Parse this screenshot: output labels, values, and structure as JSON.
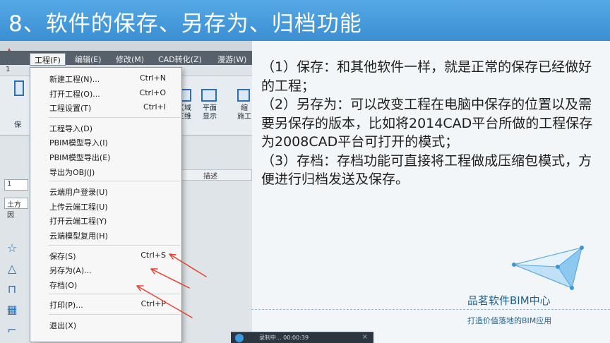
{
  "slide": {
    "title": "8、软件的保存、另存为、归档功能"
  },
  "app": {
    "menubar": [
      {
        "label": "工程(F)",
        "active": true
      },
      {
        "label": "编辑(E)",
        "active": false
      },
      {
        "label": "修改(M)",
        "active": false
      },
      {
        "label": "CAD转化(Z)",
        "active": false
      },
      {
        "label": "漫游(W)",
        "active": false
      }
    ],
    "ribbon_buttons": [
      {
        "label": "区域\n三维"
      },
      {
        "label": "平面\n显示"
      },
      {
        "label": "缩\n施工"
      }
    ],
    "ribbon_left_label": "保",
    "tab_label": "1",
    "desc_column": "描述",
    "side_inputs": [
      "1",
      "土方因"
    ],
    "side_tools": [
      "star-icon",
      "mountain-icon",
      "pipe-icon",
      "building-icon",
      "hook-icon"
    ],
    "file_menu": {
      "groups": [
        [
          {
            "label": "新建工程(N)...",
            "shortcut": "Ctrl+N"
          },
          {
            "label": "打开工程(O)...",
            "shortcut": "Ctrl+O"
          },
          {
            "label": "工程设置(T)",
            "shortcut": "Ctrl+I"
          }
        ],
        [
          {
            "label": "工程导入(D)",
            "shortcut": ""
          },
          {
            "label": "PBIM模型导入(I)",
            "shortcut": ""
          },
          {
            "label": "PBIM模型导出(E)",
            "shortcut": ""
          },
          {
            "label": "导出为OBJ(J)",
            "shortcut": ""
          }
        ],
        [
          {
            "label": "云端用户登录(U)",
            "shortcut": ""
          },
          {
            "label": "上传云端工程(U)",
            "shortcut": ""
          },
          {
            "label": "打开云端工程(Y)",
            "shortcut": ""
          },
          {
            "label": "云端模型复用(H)",
            "shortcut": ""
          }
        ],
        [
          {
            "label": "保存(S)",
            "shortcut": "Ctrl+S"
          },
          {
            "label": "另存为(A)...",
            "shortcut": ""
          },
          {
            "label": "存档(O)",
            "shortcut": ""
          }
        ],
        [
          {
            "label": "打印(P)...",
            "shortcut": "Ctrl+P"
          }
        ],
        [
          {
            "label": "退出(X)",
            "shortcut": ""
          }
        ]
      ]
    }
  },
  "content": {
    "paragraphs": [
      "（1）保存：和其他软件一样，就是正常的保存已经做好的工程；",
      "（2）另存为：可以改变工程在电脑中保存的位置以及需要另保存的版本，比如将2014CAD平台所做的工程保存为2008CAD平台可打开的模式；",
      "（3）存档：存档功能可直接将工程做成压缩包模式，方便进行归档发送及保存。"
    ]
  },
  "brand": {
    "name": "品茗软件BIM中心",
    "slogan": "打造价值落地的BIM应用",
    "accent": "#3a8fd2"
  },
  "recorder": {
    "status": "录制中... 00:00:39"
  },
  "colors": {
    "title_bar": "#3a8fd2",
    "arrow": "#e8412f"
  }
}
